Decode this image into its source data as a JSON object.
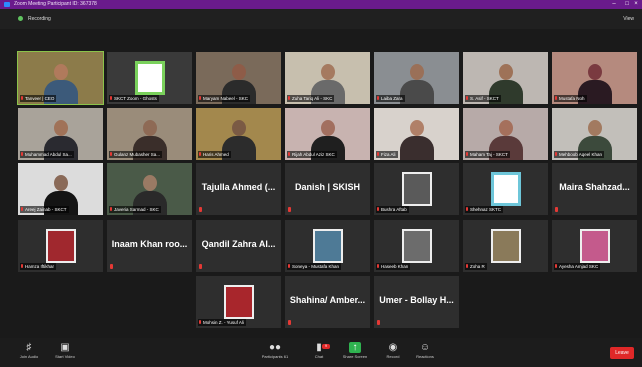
{
  "window": {
    "title": "Zoom Meeting Participant ID: 367378"
  },
  "topbar": {
    "recording_label": "Recording",
    "view_label": "View"
  },
  "tiles": [
    {
      "label": "Tanveer | CEO",
      "big": "",
      "kind": "video",
      "bg": "#8c7b4a",
      "face": "#b07a5c",
      "shirt": "#3c5a7a"
    },
    {
      "label": "SKCT Zoom - Ghosts",
      "big": "",
      "kind": "logo",
      "bg": "#3a3a3a",
      "accent": "#7ad15c"
    },
    {
      "label": "Maryam Nabeel - SKC",
      "big": "",
      "kind": "video",
      "bg": "#7a6a5a",
      "face": "#8e5c48",
      "shirt": "#2b2b2b"
    },
    {
      "label": "Zuha Tariq Ali - SKC",
      "big": "",
      "kind": "video",
      "bg": "#c7bfae",
      "face": "#a57a60",
      "shirt": "#6a6a6a"
    },
    {
      "label": "Laiba Zara",
      "big": "",
      "kind": "video",
      "bg": "#8a8e92",
      "face": "#9a7058",
      "shirt": "#4a4a4a"
    },
    {
      "label": "S. Asif - SKCT",
      "big": "",
      "kind": "video",
      "bg": "#bdb7b2",
      "face": "#9e7258",
      "shirt": "#2f3a2c"
    },
    {
      "label": "Mustafa Noh",
      "big": "",
      "kind": "video",
      "bg": "#b58a7e",
      "face": "#7a3a40",
      "shirt": "#2a1a22"
    },
    {
      "label": "Muhammad Abdul Sa...",
      "big": "",
      "kind": "video",
      "bg": "#a9a39a",
      "face": "#a07258",
      "shirt": "#2a2a30"
    },
    {
      "label": "Gulanz Mubasher Sa...",
      "big": "",
      "kind": "video",
      "bg": "#9a8c7a",
      "face": "#8e6a55",
      "shirt": "#3a2e2a"
    },
    {
      "label": "Haris Ahmed",
      "big": "",
      "kind": "video",
      "bg": "#a3884d",
      "face": "#7a5a44",
      "shirt": "#2c2c2c"
    },
    {
      "label": "Rijah Abdul Aziz SKC",
      "big": "",
      "kind": "video",
      "bg": "#c8b3b0",
      "face": "#a26f5f",
      "shirt": "#1f1f1f"
    },
    {
      "label": "Fiza Ali",
      "big": "",
      "kind": "video",
      "bg": "#d8d2cc",
      "face": "#b08068",
      "shirt": "#3a2e2e"
    },
    {
      "label": "Maham Taj - SKCT",
      "big": "",
      "kind": "video",
      "bg": "#b7aaa8",
      "face": "#a5705c",
      "shirt": "#5a3a3a"
    },
    {
      "label": "Mehboob Aqeel Khan",
      "big": "",
      "kind": "video",
      "bg": "#c2bfba",
      "face": "#a27a60",
      "shirt": "#3c4a3c"
    },
    {
      "label": "Areej Zainab - SKCT",
      "big": "",
      "kind": "video",
      "bg": "#dcdcdc",
      "face": "#8a6a58",
      "shirt": "#141414"
    },
    {
      "label": "Javeria Sarmad - SKC",
      "big": "",
      "kind": "video",
      "bg": "#4a5a48",
      "face": "#9a7a64",
      "shirt": "#2a2a2a"
    },
    {
      "label": "",
      "big": "Tajulla Ahmed (...",
      "kind": "name",
      "bg": "#2e2e2e"
    },
    {
      "label": "",
      "big": "Danish | SKISH",
      "kind": "name",
      "bg": "#2e2e2e"
    },
    {
      "label": "Bushra Aftab",
      "big": "",
      "kind": "photo",
      "bg": "#2e2e2e",
      "accent": "#5a5a5a"
    },
    {
      "label": "Shehnaz SKTC",
      "big": "",
      "kind": "logo",
      "bg": "#2e2e2e",
      "accent": "#6ec6d9"
    },
    {
      "label": "",
      "big": "Maira Shahzad...",
      "kind": "name",
      "bg": "#2e2e2e"
    },
    {
      "label": "Hamza Iftikhar",
      "big": "",
      "kind": "photo",
      "bg": "#2e2e2e",
      "accent": "#a0282e"
    },
    {
      "label": "",
      "big": "Inaam Khan roo...",
      "kind": "name",
      "bg": "#2e2e2e"
    },
    {
      "label": "",
      "big": "Qandil Zahra Al...",
      "kind": "name",
      "bg": "#2e2e2e"
    },
    {
      "label": "Soneya - Mustafa Khan",
      "big": "",
      "kind": "photo",
      "bg": "#2e2e2e",
      "accent": "#4e7a96"
    },
    {
      "label": "Haseeb Khan",
      "big": "",
      "kind": "photo",
      "bg": "#2e2e2e",
      "accent": "#6c6c6c"
    },
    {
      "label": "Zoha R",
      "big": "",
      "kind": "photo",
      "bg": "#2e2e2e",
      "accent": "#8a7a5a"
    },
    {
      "label": "Ayesha Amjad SKC",
      "big": "",
      "kind": "photo",
      "bg": "#2e2e2e",
      "accent": "#c45a8c"
    },
    {
      "label": "Mohsin Z. - Yusuf Ali",
      "big": "",
      "kind": "photo",
      "bg": "#2e2e2e",
      "accent": "#a8262c"
    },
    {
      "label": "",
      "big": "Shahina/ Amber...",
      "kind": "name",
      "bg": "#2e2e2e"
    },
    {
      "label": "",
      "big": "Umer - Bollay H...",
      "kind": "name",
      "bg": "#2e2e2e"
    }
  ],
  "toolbar": {
    "unmute": "Join Audio",
    "video": "Start Video",
    "participants": "Participants",
    "participants_count": "61",
    "chat": "Chat",
    "chat_badge": "9",
    "share": "Share Screen",
    "record": "Record",
    "reactions": "Reactions",
    "end": "Leave"
  }
}
